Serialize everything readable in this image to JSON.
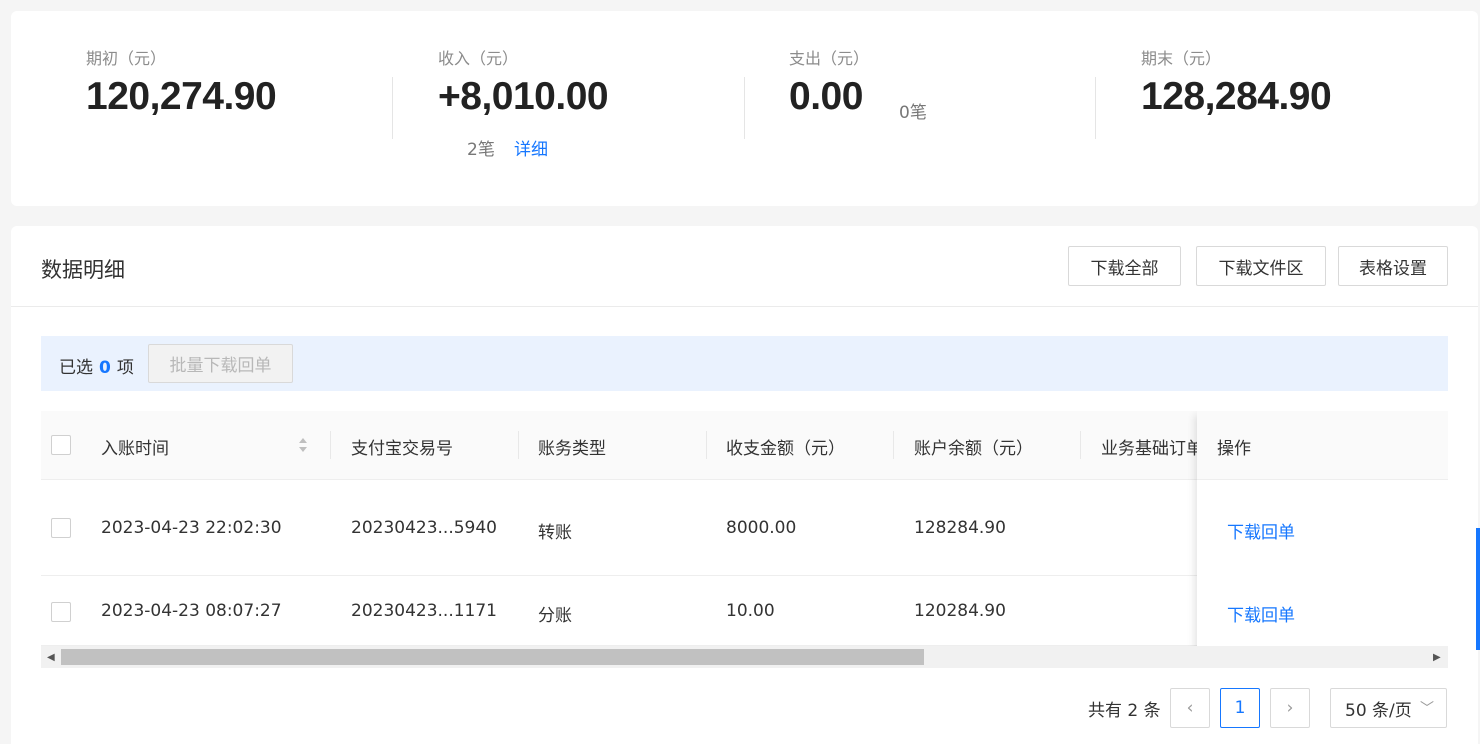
{
  "summary": {
    "opening": {
      "label": "期初（元）",
      "value": "120,274.90"
    },
    "income": {
      "label": "收入（元）",
      "value": "+8,010.00",
      "count": "2笔",
      "detail": "详细"
    },
    "expense": {
      "label": "支出（元）",
      "value": "0.00",
      "count": "0笔"
    },
    "closing": {
      "label": "期末（元）",
      "value": "128,284.90"
    }
  },
  "details": {
    "title": "数据明细",
    "buttons": {
      "download_all": "下载全部",
      "download_area": "下载文件区",
      "table_settings": "表格设置"
    },
    "selection": {
      "prefix": "已选",
      "count": "0",
      "suffix": "项",
      "batch_button": "批量下载回单"
    }
  },
  "table": {
    "columns": [
      "入账时间",
      "支付宝交易号",
      "账务类型",
      "收支金额（元）",
      "账户余额（元）",
      "业务基础订单号",
      "操作"
    ],
    "rows": [
      {
        "time": "2023-04-23 22:02:30",
        "trade_no": "20230423...5940",
        "type": "转账",
        "amount": "8000.00",
        "balance": "128284.90",
        "action": "下载回单"
      },
      {
        "time": "2023-04-23 08:07:27",
        "trade_no": "20230423...1171",
        "type": "分账",
        "amount": "10.00",
        "balance": "120284.90",
        "action": "下载回单"
      }
    ]
  },
  "pagination": {
    "total": "共有 2 条",
    "current": "1",
    "page_size": "50 条/页"
  },
  "icons": {
    "sort": "sort-icon",
    "prev": "chevron-left-icon",
    "next": "chevron-right-icon",
    "dropdown": "chevron-down-icon"
  },
  "colors": {
    "accent": "#1677ff",
    "selection_bg": "#eaf2fe"
  }
}
